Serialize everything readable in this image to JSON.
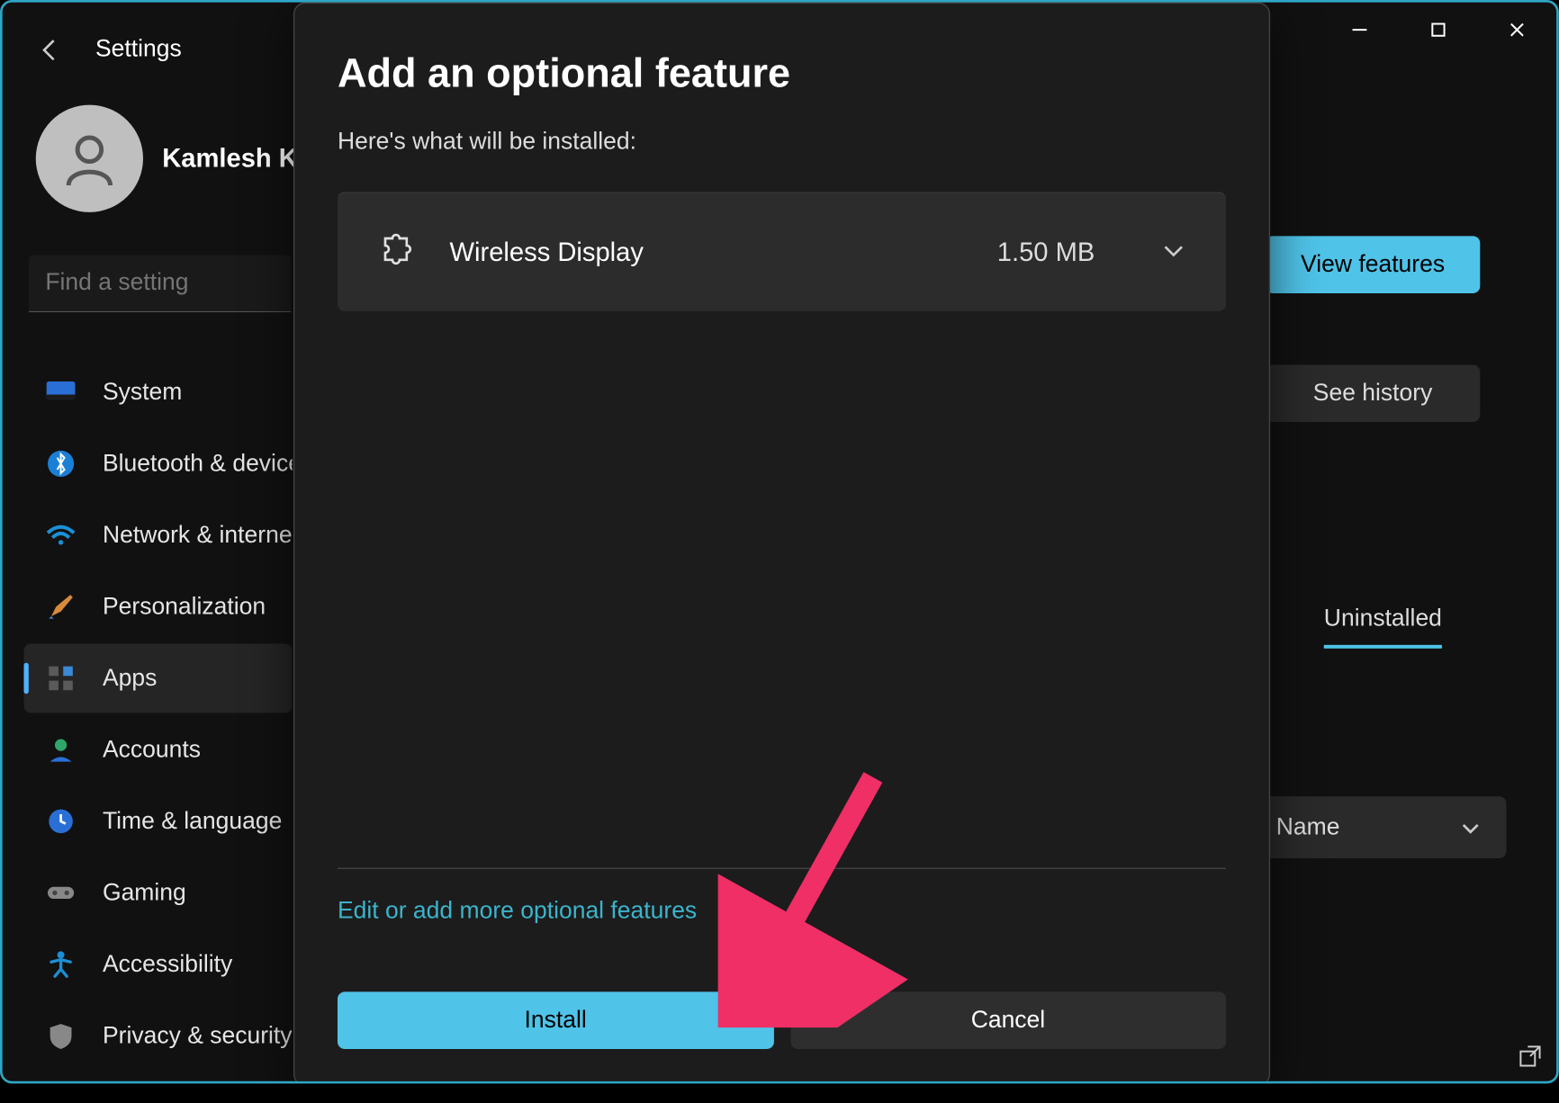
{
  "window": {
    "back_label": "←",
    "title": "Settings",
    "minimize": "—",
    "maximize": "▢",
    "close": "✕"
  },
  "profile": {
    "name": "Kamlesh Ku"
  },
  "search": {
    "placeholder": "Find a setting"
  },
  "sidebar": {
    "items": [
      {
        "label": "System"
      },
      {
        "label": "Bluetooth & devices"
      },
      {
        "label": "Network & internet"
      },
      {
        "label": "Personalization"
      },
      {
        "label": "Apps"
      },
      {
        "label": "Accounts"
      },
      {
        "label": "Time & language"
      },
      {
        "label": "Gaming"
      },
      {
        "label": "Accessibility"
      },
      {
        "label": "Privacy & security"
      }
    ]
  },
  "right_panel": {
    "view_features": "View features",
    "see_history": "See history",
    "tab_uninstalled": "Uninstalled",
    "sort_label": "Name"
  },
  "dialog": {
    "title": "Add an optional feature",
    "subtitle": "Here's what will be installed:",
    "feature": {
      "name": "Wireless Display",
      "size": "1.50 MB"
    },
    "edit_link": "Edit or add more optional features",
    "install": "Install",
    "cancel": "Cancel"
  }
}
